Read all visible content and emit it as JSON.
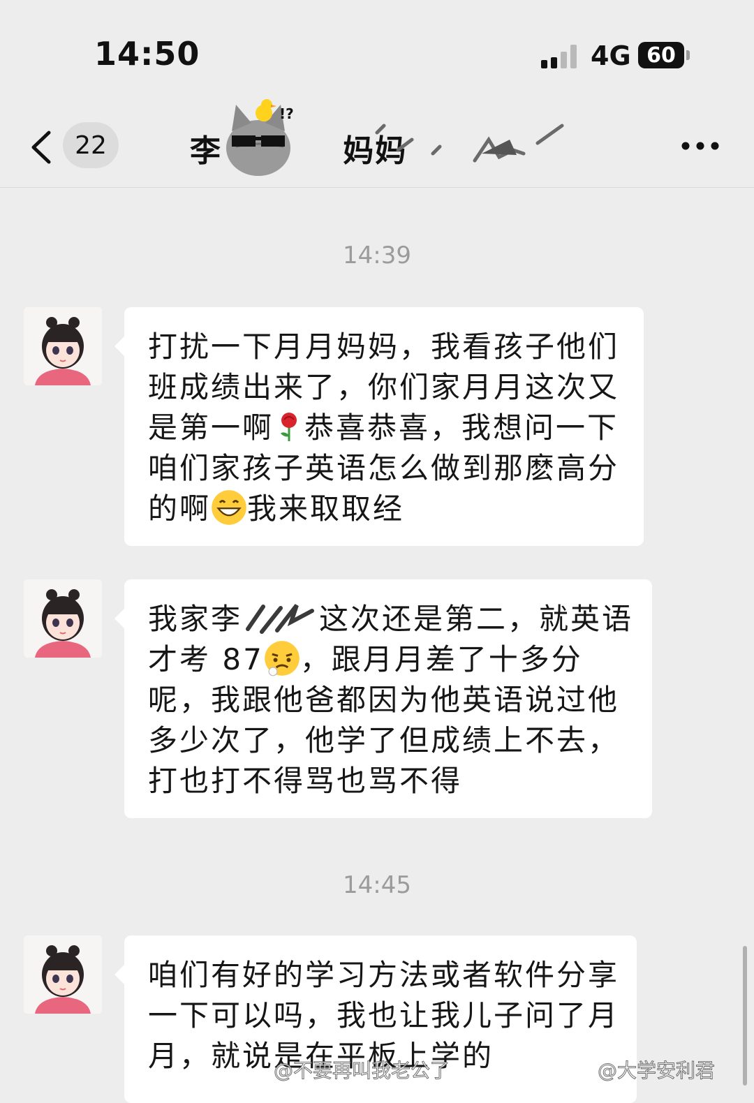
{
  "status": {
    "time": "14:50",
    "network": "4G",
    "battery": "60"
  },
  "nav": {
    "unread_count": "22",
    "title_prefix": "李",
    "title_suffix": "妈妈"
  },
  "timestamps": [
    "14:39",
    "14:45"
  ],
  "messages": [
    {
      "parts": [
        "打扰一下月月妈妈，我看孩子他们班成绩出来了，你们家月月这次又是第一啊",
        "恭喜恭喜，我想问一下咱们家孩子英语怎么做到那麽高分的啊",
        "我来取取经"
      ],
      "emojis": [
        "rose-emoji",
        "grin-emoji"
      ]
    },
    {
      "parts": [
        "我家李",
        "这次还是第二，就英语才考 87",
        "，跟月月差了十多分呢，我跟他爸都因为他英语说过他多少次了，他学了但成绩上不去，打也打不得骂也骂不得"
      ],
      "emojis": [
        "redacted-scribble",
        "sad-emoji"
      ]
    },
    {
      "parts": [
        "咱们有好的学习方法或者软件分享一下可以吗，我也让我儿子问了月月，就说是在平板上学的"
      ],
      "emojis": []
    }
  ],
  "watermarks": [
    "@不要再叫我老公了",
    "@大学安利君"
  ],
  "colors": {
    "background": "#ededed",
    "bubble": "#ffffff",
    "timestamp": "#9b9b9b"
  }
}
